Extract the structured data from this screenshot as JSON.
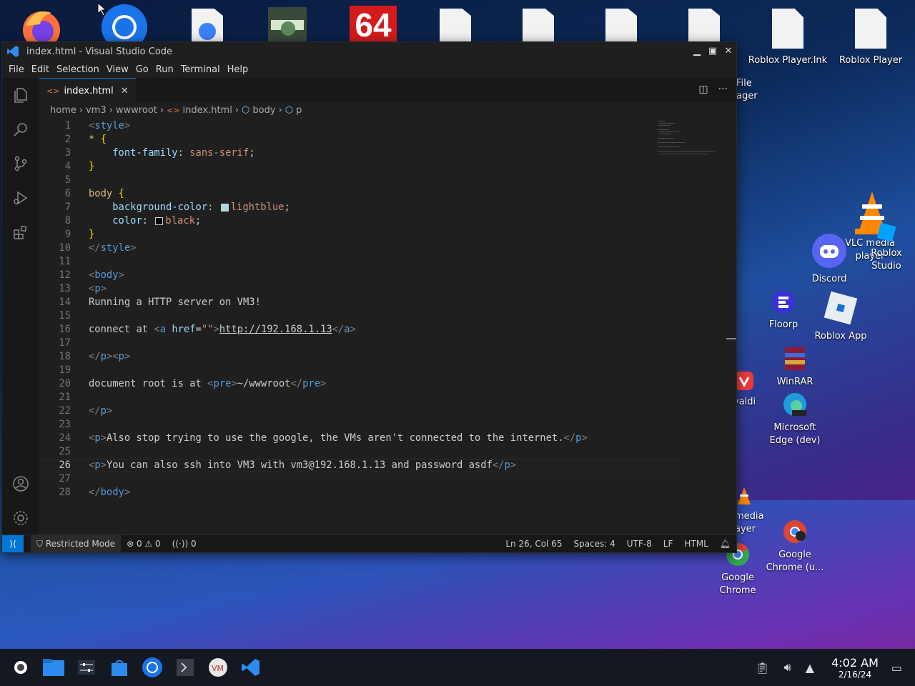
{
  "desktop": {
    "top_icons": [
      {
        "name": "firefox"
      },
      {
        "name": "chrome"
      },
      {
        "name": "globe"
      },
      {
        "name": "game"
      },
      {
        "name": "aida64",
        "label": "64"
      },
      {
        "name": "file1"
      },
      {
        "name": "file2"
      },
      {
        "name": "file3"
      },
      {
        "name": "file4"
      }
    ],
    "labeled_icons": [
      {
        "label": "Roblox Player.lnk"
      },
      {
        "label": "Roblox Player"
      },
      {
        "label": "Discord"
      },
      {
        "label": "VLC media player"
      },
      {
        "label": "Roblox Studio"
      },
      {
        "label": "Floorp"
      },
      {
        "label": "Roblox App"
      },
      {
        "label": "WinRAR"
      },
      {
        "label": "Microsoft Edge (dev)"
      },
      {
        "label": "Google Chrome (u..."
      },
      {
        "label": "Google Chrome"
      },
      {
        "label": "valdi"
      },
      {
        "label": "media ayer"
      },
      {
        "label": "File ager"
      }
    ]
  },
  "window": {
    "title": "index.html - Visual Studio Code",
    "menu": [
      "File",
      "Edit",
      "Selection",
      "View",
      "Go",
      "Run",
      "Terminal",
      "Help"
    ],
    "tab": "index.html",
    "breadcrumb": [
      "home",
      "vm3",
      "wwwroot",
      "index.html",
      "body",
      "p"
    ],
    "code_lines": [
      {
        "n": "1",
        "tokens": [
          [
            "tag",
            "<"
          ],
          [
            "tn",
            "style"
          ],
          [
            "tag",
            ">"
          ]
        ]
      },
      {
        "n": "2",
        "tokens": [
          [
            "sel",
            "*"
          ],
          [
            "txt",
            " "
          ],
          [
            "brace",
            "{"
          ]
        ]
      },
      {
        "n": "3",
        "tokens": [
          [
            "txt",
            "    "
          ],
          [
            "prop",
            "font-family"
          ],
          [
            "txt",
            ": "
          ],
          [
            "val",
            "sans-serif"
          ],
          [
            "txt",
            ";"
          ]
        ]
      },
      {
        "n": "4",
        "tokens": [
          [
            "brace",
            "}"
          ]
        ]
      },
      {
        "n": "5",
        "tokens": []
      },
      {
        "n": "6",
        "tokens": [
          [
            "sel",
            "body"
          ],
          [
            "txt",
            " "
          ],
          [
            "brace",
            "{"
          ]
        ]
      },
      {
        "n": "7",
        "tokens": [
          [
            "txt",
            "    "
          ],
          [
            "prop",
            "background-color"
          ],
          [
            "txt",
            ": "
          ],
          [
            "swatch",
            "#add8e6"
          ],
          [
            "val",
            "lightblue"
          ],
          [
            "txt",
            ";"
          ]
        ]
      },
      {
        "n": "8",
        "tokens": [
          [
            "txt",
            "    "
          ],
          [
            "prop",
            "color"
          ],
          [
            "txt",
            ": "
          ],
          [
            "swatch",
            "#000000"
          ],
          [
            "val",
            "black"
          ],
          [
            "txt",
            ";"
          ]
        ]
      },
      {
        "n": "9",
        "tokens": [
          [
            "brace",
            "}"
          ]
        ]
      },
      {
        "n": "10",
        "tokens": [
          [
            "tag",
            "</"
          ],
          [
            "tn",
            "style"
          ],
          [
            "tag",
            ">"
          ]
        ]
      },
      {
        "n": "11",
        "tokens": []
      },
      {
        "n": "12",
        "tokens": [
          [
            "tag",
            "<"
          ],
          [
            "tn",
            "body"
          ],
          [
            "tag",
            ">"
          ]
        ]
      },
      {
        "n": "13",
        "tokens": [
          [
            "tag",
            "<"
          ],
          [
            "tn",
            "p"
          ],
          [
            "tag",
            ">"
          ]
        ]
      },
      {
        "n": "14",
        "tokens": [
          [
            "txt",
            "Running a HTTP server on VM3!"
          ]
        ]
      },
      {
        "n": "15",
        "tokens": []
      },
      {
        "n": "16",
        "tokens": [
          [
            "txt",
            "connect at "
          ],
          [
            "tag",
            "<"
          ],
          [
            "tn",
            "a"
          ],
          [
            "txt",
            " "
          ],
          [
            "prop",
            "href"
          ],
          [
            "txt",
            "="
          ],
          [
            "val",
            "\"\""
          ],
          [
            "tag",
            ">"
          ],
          [
            "link",
            "http://192.168.1.13"
          ],
          [
            "tag",
            "</"
          ],
          [
            "tn",
            "a"
          ],
          [
            "tag",
            ">"
          ]
        ]
      },
      {
        "n": "17",
        "tokens": []
      },
      {
        "n": "18",
        "tokens": [
          [
            "tag",
            "</"
          ],
          [
            "tn",
            "p"
          ],
          [
            "tag",
            "><"
          ],
          [
            "tn",
            "p"
          ],
          [
            "tag",
            ">"
          ]
        ]
      },
      {
        "n": "19",
        "tokens": []
      },
      {
        "n": "20",
        "tokens": [
          [
            "txt",
            "document root is at "
          ],
          [
            "tag",
            "<"
          ],
          [
            "tn",
            "pre"
          ],
          [
            "tag",
            ">"
          ],
          [
            "txt",
            "~/wwwroot"
          ],
          [
            "tag",
            "</"
          ],
          [
            "tn",
            "pre"
          ],
          [
            "tag",
            ">"
          ]
        ]
      },
      {
        "n": "21",
        "tokens": []
      },
      {
        "n": "22",
        "tokens": [
          [
            "tag",
            "</"
          ],
          [
            "tn",
            "p"
          ],
          [
            "tag",
            ">"
          ]
        ]
      },
      {
        "n": "23",
        "tokens": []
      },
      {
        "n": "24",
        "tokens": [
          [
            "tag",
            "<"
          ],
          [
            "tn",
            "p"
          ],
          [
            "tag",
            ">"
          ],
          [
            "txt",
            "Also stop trying to use the google, the VMs aren't connected to the internet."
          ],
          [
            "tag",
            "</"
          ],
          [
            "tn",
            "p"
          ],
          [
            "tag",
            ">"
          ]
        ]
      },
      {
        "n": "25",
        "tokens": []
      },
      {
        "n": "26",
        "tokens": [
          [
            "tag",
            "<"
          ],
          [
            "tn",
            "p"
          ],
          [
            "tag",
            ">"
          ],
          [
            "txt",
            "You can also ssh into VM3 with vm3@192.168.1.13 and password asdf"
          ],
          [
            "tag",
            "</"
          ],
          [
            "tn",
            "p"
          ],
          [
            "tag",
            ">"
          ]
        ]
      },
      {
        "n": "27",
        "tokens": []
      },
      {
        "n": "28",
        "tokens": [
          [
            "tag",
            "</"
          ],
          [
            "tn",
            "body"
          ],
          [
            "tag",
            ">"
          ]
        ]
      }
    ],
    "active_line": "26",
    "status": {
      "restricted": "Restricted Mode",
      "errors": "0",
      "warnings": "0",
      "ports": "0",
      "position": "Ln 26, Col 65",
      "spaces": "Spaces: 4",
      "encoding": "UTF-8",
      "eol": "LF",
      "language": "HTML"
    }
  },
  "taskbar": {
    "time": "4:02 AM",
    "date": "2/16/24"
  },
  "colors": {
    "accent": "#0078d4",
    "editor_bg": "#1f1f1f",
    "sidebar_bg": "#181818"
  }
}
